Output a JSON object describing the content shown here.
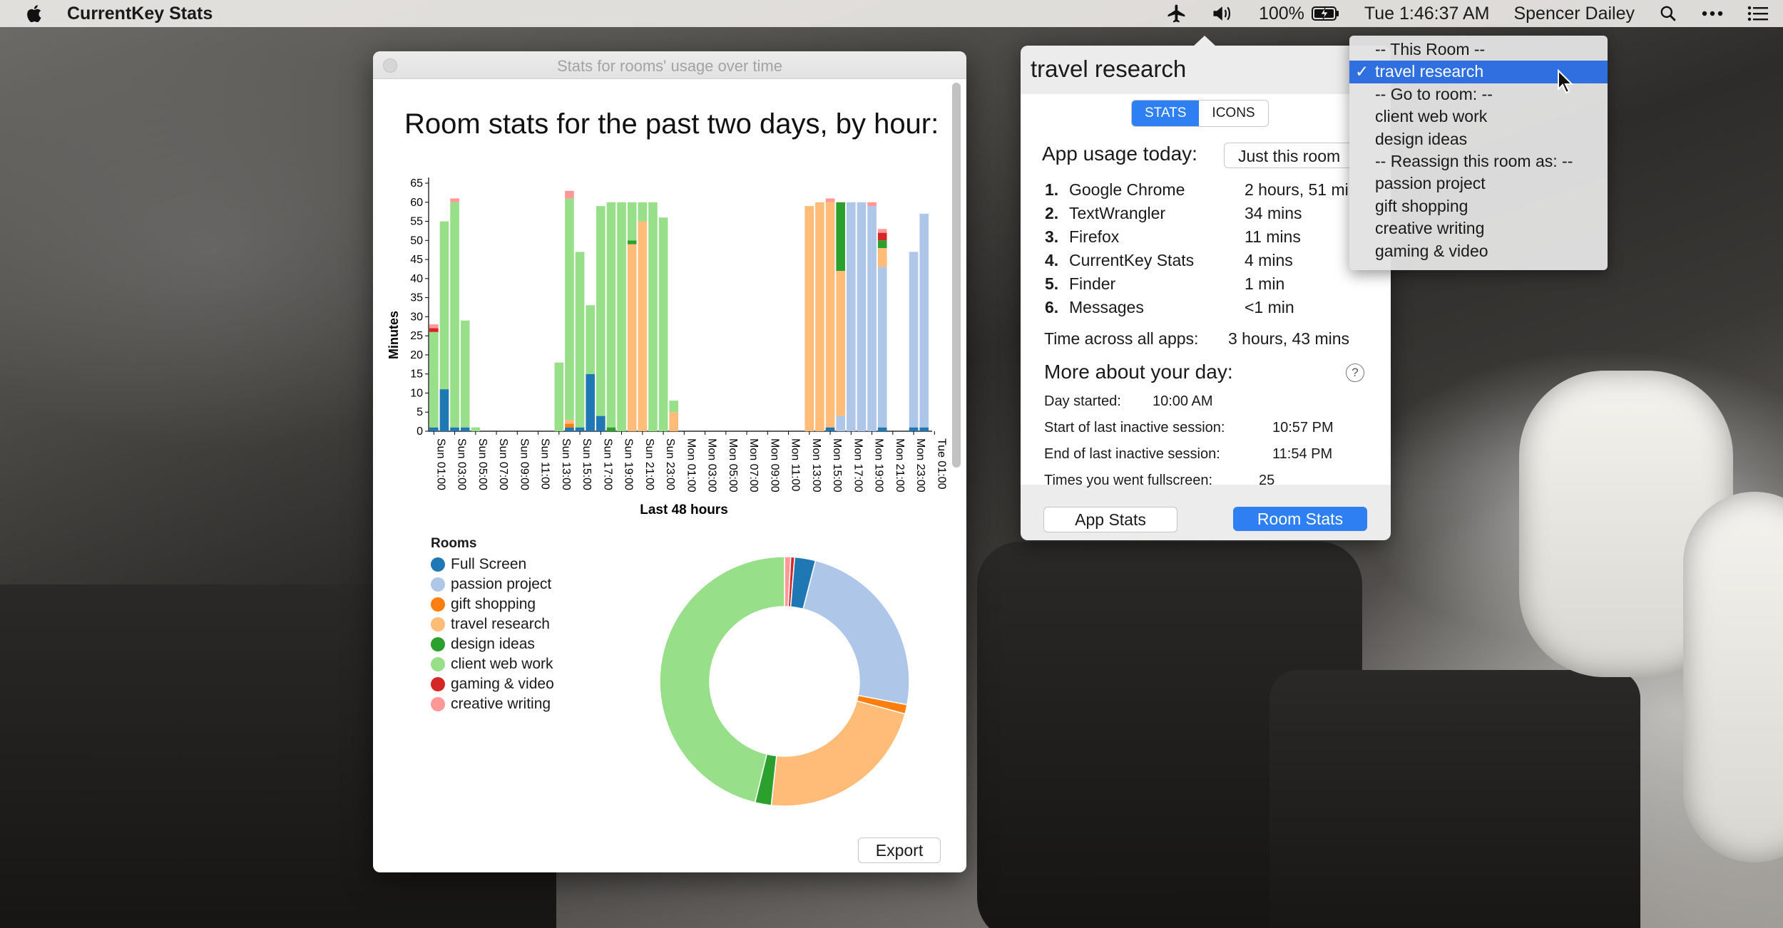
{
  "menubar": {
    "app_name": "CurrentKey Stats",
    "battery": "100%",
    "clock": "Tue 1:46:37 AM",
    "user": "Spencer Dailey"
  },
  "stats_window": {
    "title": "Stats for rooms' usage over time",
    "heading": "Room stats for the past two days, by hour:",
    "export_label": "Export",
    "legend_title": "Rooms",
    "rooms": [
      {
        "name": "Full Screen",
        "color": "#1f77b4"
      },
      {
        "name": "passion project",
        "color": "#aec7e8"
      },
      {
        "name": "gift shopping",
        "color": "#ff7f0e"
      },
      {
        "name": "travel research",
        "color": "#ffbb78"
      },
      {
        "name": "design ideas",
        "color": "#2ca02c"
      },
      {
        "name": "client web work",
        "color": "#98df8a"
      },
      {
        "name": "gaming & video",
        "color": "#d62728"
      },
      {
        "name": "creative writing",
        "color": "#ff9896"
      }
    ]
  },
  "chart_data": [
    {
      "type": "bar",
      "stacked": true,
      "ylabel": "Minutes",
      "xlabel": "Last 48 hours",
      "ylim": [
        0,
        65
      ],
      "yticks": [
        0,
        5,
        10,
        15,
        20,
        25,
        30,
        35,
        40,
        45,
        50,
        55,
        60,
        65
      ],
      "tick_labels": [
        "Sun 01:00",
        "Sun 03:00",
        "Sun 05:00",
        "Sun 07:00",
        "Sun 09:00",
        "Sun 11:00",
        "Sun 13:00",
        "Sun 15:00",
        "Sun 17:00",
        "Sun 19:00",
        "Sun 21:00",
        "Sun 23:00",
        "Mon 01:00",
        "Mon 03:00",
        "Mon 05:00",
        "Mon 07:00",
        "Mon 09:00",
        "Mon 11:00",
        "Mon 13:00",
        "Mon 15:00",
        "Mon 17:00",
        "Mon 19:00",
        "Mon 21:00",
        "Mon 23:00",
        "Tue 01:00"
      ],
      "series_order": [
        "Full Screen",
        "passion project",
        "gift shopping",
        "travel research",
        "design ideas",
        "client web work",
        "gaming & video",
        "creative writing"
      ],
      "bars": [
        [
          1,
          0,
          0,
          0,
          0,
          25,
          1,
          1
        ],
        [
          11,
          0,
          0,
          0,
          0,
          44,
          0,
          0
        ],
        [
          1,
          0,
          0,
          0,
          0,
          59,
          0,
          1
        ],
        [
          1,
          0,
          0,
          0,
          0,
          28,
          0,
          0
        ],
        [
          0,
          0,
          0,
          0,
          0,
          1,
          0,
          0
        ],
        [
          0,
          0,
          0,
          0,
          0,
          0,
          0,
          0
        ],
        [
          0,
          0,
          0,
          0,
          0,
          0,
          0,
          0
        ],
        [
          0,
          0,
          0,
          0,
          0,
          0,
          0,
          0
        ],
        [
          0,
          0,
          0,
          0,
          0,
          0,
          0,
          0
        ],
        [
          0,
          0,
          0,
          0,
          0,
          0,
          0,
          0
        ],
        [
          0,
          0,
          0,
          0,
          0,
          0,
          0,
          0
        ],
        [
          0,
          0,
          0,
          0,
          0,
          0,
          0,
          0
        ],
        [
          0,
          0,
          0,
          0,
          0,
          18,
          0,
          0
        ],
        [
          1,
          0,
          1,
          1,
          0,
          58,
          0,
          2
        ],
        [
          1,
          0,
          0,
          0,
          0,
          46,
          0,
          0
        ],
        [
          15,
          0,
          0,
          0,
          0,
          18,
          0,
          0
        ],
        [
          4,
          0,
          0,
          0,
          0,
          55,
          0,
          0
        ],
        [
          0,
          0,
          0,
          0,
          1,
          59,
          0,
          0
        ],
        [
          0,
          0,
          0,
          0,
          0,
          60,
          0,
          0
        ],
        [
          0,
          0,
          0,
          49,
          1,
          10,
          0,
          0
        ],
        [
          0,
          0,
          0,
          55,
          0,
          5,
          0,
          0
        ],
        [
          0,
          0,
          0,
          0,
          0,
          60,
          0,
          0
        ],
        [
          0,
          0,
          0,
          0,
          0,
          56,
          0,
          0
        ],
        [
          0,
          0,
          0,
          5,
          0,
          3,
          0,
          0
        ],
        [
          0,
          0,
          0,
          0,
          0,
          0,
          0,
          0
        ],
        [
          0,
          0,
          0,
          0,
          0,
          0,
          0,
          0
        ],
        [
          0,
          0,
          0,
          0,
          0,
          0,
          0,
          0
        ],
        [
          0,
          0,
          0,
          0,
          0,
          0,
          0,
          0
        ],
        [
          0,
          0,
          0,
          0,
          0,
          0,
          0,
          0
        ],
        [
          0,
          0,
          0,
          0,
          0,
          0,
          0,
          0
        ],
        [
          0,
          0,
          0,
          0,
          0,
          0,
          0,
          0
        ],
        [
          0,
          0,
          0,
          0,
          0,
          0,
          0,
          0
        ],
        [
          0,
          0,
          0,
          0,
          0,
          0,
          0,
          0
        ],
        [
          0,
          0,
          0,
          0,
          0,
          0,
          0,
          0
        ],
        [
          0,
          0,
          0,
          0,
          0,
          0,
          0,
          0
        ],
        [
          0,
          0,
          0,
          0,
          0,
          0,
          0,
          0
        ],
        [
          0,
          0,
          0,
          59,
          0,
          0,
          0,
          0
        ],
        [
          0,
          0,
          0,
          60,
          0,
          0,
          0,
          0
        ],
        [
          1,
          0,
          0,
          59,
          0,
          0,
          0,
          1
        ],
        [
          0,
          4,
          0,
          38,
          18,
          0,
          0,
          0
        ],
        [
          0,
          60,
          0,
          0,
          0,
          0,
          0,
          0
        ],
        [
          0,
          60,
          0,
          0,
          0,
          0,
          0,
          0
        ],
        [
          0,
          59,
          0,
          0,
          0,
          0,
          0,
          1
        ],
        [
          1,
          42,
          0,
          5,
          2,
          0,
          2,
          1
        ],
        [
          0,
          0,
          0,
          0,
          0,
          0,
          0,
          0
        ],
        [
          0,
          0,
          0,
          0,
          0,
          0,
          0,
          0
        ],
        [
          1,
          46,
          0,
          0,
          0,
          0,
          0,
          0
        ],
        [
          1,
          56,
          0,
          0,
          0,
          0,
          0,
          0
        ]
      ]
    },
    {
      "type": "pie",
      "donut": true,
      "labels": [
        "creative writing",
        "gaming & video",
        "Full Screen",
        "passion project",
        "gift shopping",
        "travel research",
        "design ideas",
        "client web work"
      ],
      "values": [
        0.8,
        0.5,
        2.7,
        24,
        1.2,
        22.5,
        2.1,
        46.2
      ]
    }
  ],
  "popover": {
    "title": "travel research",
    "tabs": [
      "STATS",
      "ICONS"
    ],
    "app_usage_label": "App usage today:",
    "scope_button": "Just this room",
    "apps": [
      {
        "rank": "1.",
        "name": "Google Chrome",
        "time": "2 hours, 51 mi"
      },
      {
        "rank": "2.",
        "name": "TextWrangler",
        "time": "34 mins"
      },
      {
        "rank": "3.",
        "name": "Firefox",
        "time": "11 mins"
      },
      {
        "rank": "4.",
        "name": "CurrentKey Stats",
        "time": "4 mins"
      },
      {
        "rank": "5.",
        "name": "Finder",
        "time": "1 min"
      },
      {
        "rank": "6.",
        "name": "Messages",
        "time": "<1 min"
      }
    ],
    "total_label": "Time across all apps:",
    "total_value": "3 hours, 43 mins",
    "more_label": "More about your day:",
    "help_glyph": "?",
    "day_started_label": "Day started:",
    "day_started_value": "10:00 AM",
    "last_inactive_start_label": "Start of last inactive session:",
    "last_inactive_start_value": "10:57 PM",
    "last_inactive_end_label": "End of last inactive session:",
    "last_inactive_end_value": "11:54 PM",
    "fullscreen_label": "Times you went fullscreen:",
    "fullscreen_value": "25",
    "app_stats_button": "App Stats",
    "room_stats_button": "Room Stats"
  },
  "dropdown": {
    "items": [
      {
        "label": "-- This Room --",
        "selected": false
      },
      {
        "label": "travel research",
        "selected": true
      },
      {
        "label": "-- Go to room: --",
        "selected": false
      },
      {
        "label": "client web work",
        "selected": false
      },
      {
        "label": "design ideas",
        "selected": false
      },
      {
        "label": "-- Reassign this room as: --",
        "selected": false
      },
      {
        "label": "passion project",
        "selected": false
      },
      {
        "label": "gift shopping",
        "selected": false
      },
      {
        "label": "creative writing",
        "selected": false
      },
      {
        "label": "gaming & video",
        "selected": false
      }
    ],
    "check": "✓"
  }
}
